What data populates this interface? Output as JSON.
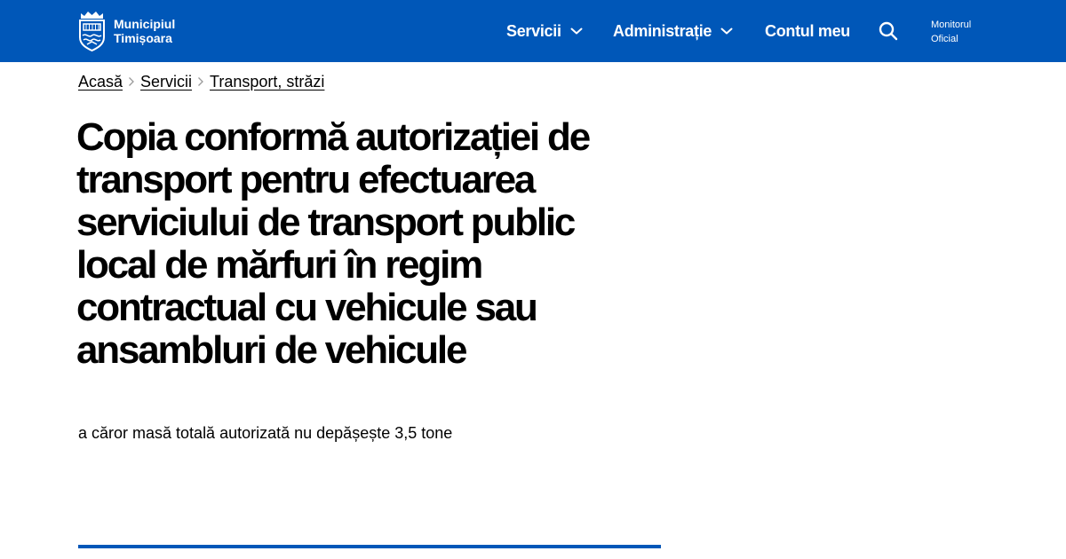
{
  "header": {
    "brand": {
      "line1": "Municipiul",
      "line2": "Timișoara",
      "icon": "city-crest-icon"
    },
    "nav": [
      {
        "label": "Servicii",
        "has_dropdown": true
      },
      {
        "label": "Administrație",
        "has_dropdown": true
      },
      {
        "label": "Contul meu",
        "has_dropdown": false
      }
    ],
    "search_icon": "search-icon",
    "monitor": {
      "line1": "Monitorul",
      "line2": "Oficial"
    }
  },
  "breadcrumb": [
    {
      "label": "Acasă"
    },
    {
      "label": "Servicii"
    },
    {
      "label": "Transport, străzi"
    }
  ],
  "page": {
    "title": "Copia conformă autorizației de transport pentru efectuarea serviciului de transport public local de mărfuri în regim contractual cu vehicule sau ansambluri de vehicule",
    "subtitle": "a căror masă totală autorizată nu depășește 3,5 tone"
  },
  "colors": {
    "brand_blue": "#0057b8",
    "text": "#000000",
    "background": "#ffffff"
  }
}
